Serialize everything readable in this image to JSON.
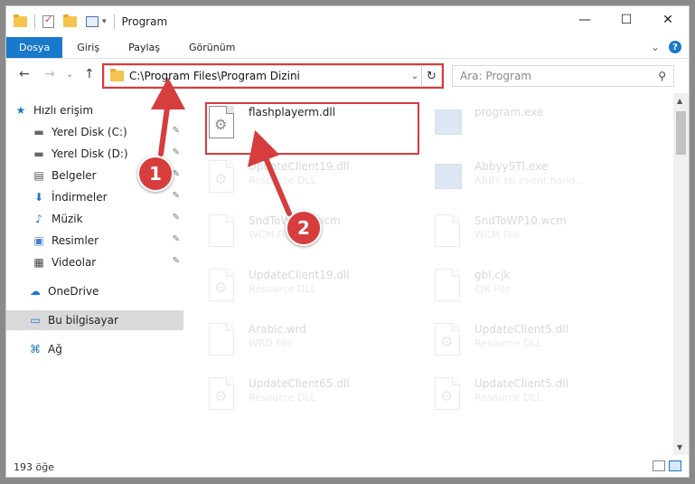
{
  "window": {
    "title": "Program",
    "controls": {
      "minimize": "—",
      "maximize": "☐",
      "close": "✕"
    }
  },
  "ribbon": {
    "tabs": [
      {
        "label": "Dosya",
        "active": true
      },
      {
        "label": "Giriş"
      },
      {
        "label": "Paylaş"
      },
      {
        "label": "Görünüm"
      }
    ],
    "chevron": "⌄",
    "help": "?"
  },
  "nav": {
    "back": "←",
    "forward": "→",
    "recent": "⌄",
    "up": "↑"
  },
  "address": {
    "path": "C:\\Program Files\\Program Dizini",
    "dropdown": "⌄",
    "refresh": "↻"
  },
  "search": {
    "placeholder": "Ara: Program",
    "icon": "⚲"
  },
  "sidebar": {
    "items": [
      {
        "label": "Hızlı erişim",
        "icon": "★",
        "color": "#1979ca"
      },
      {
        "label": "Yerel Disk (C:)",
        "icon": "▬",
        "pinned": true
      },
      {
        "label": "Yerel Disk (D:)",
        "icon": "▬",
        "pinned": true
      },
      {
        "label": "Belgeler",
        "icon": "▤",
        "pinned": true
      },
      {
        "label": "İndirmeler",
        "icon": "⬇",
        "pinned": true,
        "color": "#1979ca"
      },
      {
        "label": "Müzik",
        "icon": "♪",
        "pinned": true,
        "color": "#1979ca"
      },
      {
        "label": "Resimler",
        "icon": "▣",
        "pinned": true
      },
      {
        "label": "Videolar",
        "icon": "▦",
        "pinned": true
      },
      {
        "label": "OneDrive",
        "icon": "☁",
        "color": "#1979ca"
      },
      {
        "label": "Bu bilgisayar",
        "icon": "▭",
        "selected": true,
        "color": "#1979ca"
      },
      {
        "label": "Ağ",
        "icon": "⌘",
        "color": "#1979ca"
      }
    ],
    "pin_icon": "📌"
  },
  "files": [
    {
      "name": "flashplayerm.dll",
      "type": "",
      "icon": "dll",
      "highlighted": true
    },
    {
      "name": "program.exe",
      "type": "",
      "icon": "exe",
      "faded": true
    },
    {
      "name": "UpdateClient19.dll",
      "type": "Resource DLL",
      "icon": "dll",
      "faded": true
    },
    {
      "name": "AbbyySTI.exe",
      "type": "ABBY sti event hand...",
      "icon": "exe",
      "faded": true
    },
    {
      "name": "SndToWP10.wcm",
      "type": "WCM File",
      "icon": "doc",
      "faded": true
    },
    {
      "name": "SndToWP10.wcm",
      "type": "WCM File",
      "icon": "doc",
      "faded": true
    },
    {
      "name": "UpdateClient19.dll",
      "type": "Resource DLL",
      "icon": "dll",
      "faded": true
    },
    {
      "name": "gbl.cjk",
      "type": "CJK File",
      "icon": "doc",
      "faded": true
    },
    {
      "name": "Arabic.wrd",
      "type": "WRD File",
      "icon": "doc",
      "faded": true
    },
    {
      "name": "UpdateClient5.dll",
      "type": "Resource DLL",
      "icon": "dll",
      "faded": true
    },
    {
      "name": "UpdateClient65.dll",
      "type": "Resource DLL",
      "icon": "dll",
      "faded": true
    },
    {
      "name": "UpdateClient5.dll",
      "type": "Resource DLL",
      "icon": "dll",
      "faded": true
    }
  ],
  "status": {
    "count": "193 öğe"
  },
  "annotations": {
    "step1": "1",
    "step2": "2",
    "color": "#d63d3d"
  }
}
